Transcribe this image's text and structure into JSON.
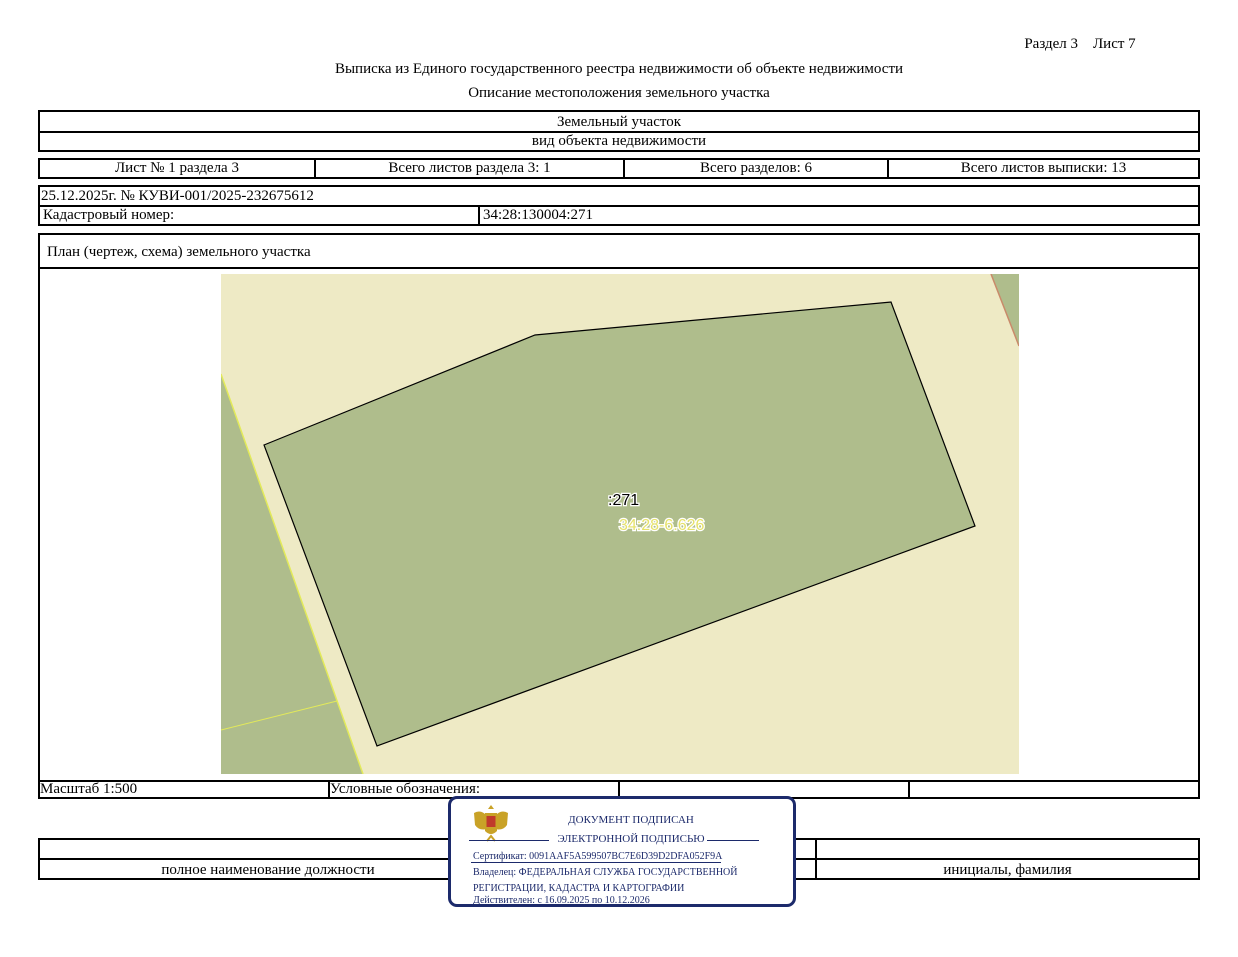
{
  "header": {
    "section_sheet": "Раздел 3    Лист 7",
    "title": "Выписка из Единого государственного реестра недвижимости об объекте недвижимости",
    "subtitle": "Описание местоположения земельного участка"
  },
  "object": {
    "type": "Земельный участок",
    "type_caption": "вид объекта недвижимости"
  },
  "sheets": {
    "sheet": "Лист № 1 раздела 3",
    "total_section_sheets": "Всего листов раздела 3: 1",
    "total_sections": "Всего разделов: 6",
    "total_extract_sheets": "Всего листов выписки: 13"
  },
  "record": {
    "date_number": "25.12.2025г. № КУВИ-001/2025-232675612",
    "cadastral_label": "Кадастровый номер:",
    "cadastral_value": "34:28:130004:271"
  },
  "plan": {
    "title": "План (чертеж, схема) земельного участка",
    "parcel_label": ":271",
    "quarter_label": "34:28-6.626",
    "colors": {
      "background": "#eeeac5",
      "parcel": "#afbd8c",
      "neighbor": "#afbd8c",
      "boundary": "#000000",
      "highlight_line": "#e3ea5a",
      "quarter_label": "#e6e26a"
    }
  },
  "footer": {
    "scale": "Масштаб 1:500",
    "legend": "Условные обозначения:",
    "position_caption": "полное наименование должности",
    "name_caption": "инициалы, фамилия"
  },
  "stamp": {
    "line1": "ДОКУМЕНТ ПОДПИСАН",
    "line2": "ЭЛЕКТРОННОЙ ПОДПИСЬЮ",
    "certificate": "Сертификат: 0091AAF5A599507BC7E6D39D2DFA052F9A",
    "owner_line1": "Владелец: ФЕДЕРАЛЬНАЯ СЛУЖБА ГОСУДАРСТВЕННОЙ",
    "owner_line2": "РЕГИСТРАЦИИ, КАДАСТРА И КАРТОГРАФИИ",
    "valid": "Действителен: с 16.09.2025 по 10.12.2026",
    "emblem_icon": "russian-eagle-emblem-icon"
  }
}
